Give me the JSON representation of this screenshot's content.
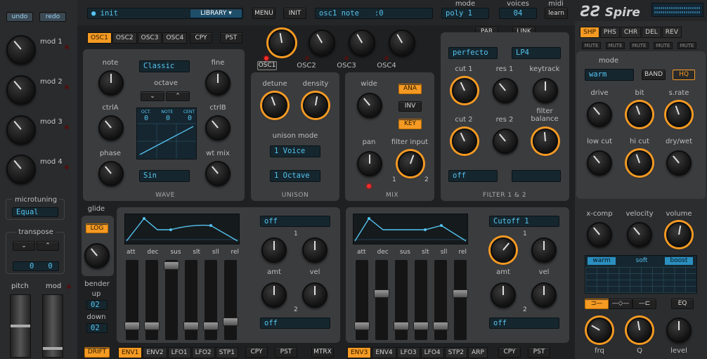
{
  "left": {
    "undo": "undo",
    "redo": "redo",
    "mods": [
      "mod 1",
      "mod 2",
      "mod 3",
      "mod 4"
    ],
    "microtuning_label": "microtuning",
    "microtuning_value": "Equal",
    "transpose_label": "transpose",
    "transpose_values": [
      "0",
      "0"
    ],
    "pitch": "pitch",
    "mod": "mod"
  },
  "topbar": {
    "patch": "init",
    "library": "LIBRARY",
    "menu": "MENU",
    "init": "INIT",
    "param_name": "osc1 note",
    "param_value": ":0",
    "mode_label": "mode",
    "mode_value": "poly 1",
    "voices_label": "voices",
    "voices_value": "04",
    "midi_label": "midi",
    "midi_learn": "learn",
    "logo": "Spire"
  },
  "osc": {
    "tabs": [
      "OSC1",
      "OSC2",
      "OSC3",
      "OSC4"
    ],
    "cpy": "CPY",
    "pst": "PST",
    "knobs": [
      "OSC1",
      "OSC2",
      "OSC3",
      "OSC4"
    ],
    "note": "note",
    "fine": "fine",
    "wave_mode": "Classic",
    "octave": "octave",
    "ctrlA": "ctrlA",
    "ctrlB": "ctrlB",
    "phase": "phase",
    "wtmix": "wt mix",
    "disp_heads": [
      "OCT.",
      "NOTE",
      "CENT"
    ],
    "disp_vals": [
      "0",
      "0",
      "0"
    ],
    "wave_shape": "Sin",
    "wave_title": "WAVE"
  },
  "unison": {
    "detune": "detune",
    "density": "density",
    "mode_label": "unison mode",
    "voice": "1 Voice",
    "octave": "1 Octave",
    "title": "UNISON"
  },
  "mix": {
    "wide": "wide",
    "ana": "ANA",
    "inv": "INV",
    "key": "KEY",
    "pan": "pan",
    "filter_input": "filter input",
    "one": "1",
    "two": "2",
    "title": "MIX"
  },
  "filter": {
    "par": "PAR",
    "link": "LINK",
    "f1_type": "perfecto",
    "f2_type": "LP4",
    "cut1": "cut 1",
    "res1": "res 1",
    "keytrack": "keytrack",
    "cut2": "cut 2",
    "res2": "res 2",
    "balance": "filter balance",
    "f1_off": "off",
    "title": "FILTER 1 & 2"
  },
  "fx": {
    "tabs": [
      "SHP",
      "PHS",
      "CHR",
      "DEL",
      "REV"
    ],
    "mute": "MUTE",
    "mode": "mode",
    "mode_val": "warm",
    "band": "BAND",
    "hq": "HQ",
    "drive": "drive",
    "bit": "bit",
    "srate": "s.rate",
    "lowcut": "low cut",
    "hicut": "hi cut",
    "drywet": "dry/wet",
    "xcomp": "x-comp",
    "velocity": "velocity",
    "volume": "volume",
    "eq_tabs": [
      "warm",
      "soft",
      "boost"
    ],
    "eq": "EQ",
    "frq": "frq",
    "q": "Q",
    "level": "level"
  },
  "env1": {
    "glide": "glide",
    "log": "LOG",
    "bender": "bender",
    "up": "up",
    "up_val": "02",
    "down": "down",
    "down_val": "02",
    "labels": [
      "att",
      "dec",
      "sus",
      "slt",
      "sll",
      "rel"
    ],
    "dest1": "off",
    "dest2": "off",
    "one": "1",
    "two": "2",
    "amt": "amt",
    "vel": "vel"
  },
  "env2": {
    "labels": [
      "att",
      "dec",
      "sus",
      "slt",
      "sll",
      "rel"
    ],
    "dest1": "Cutoff 1",
    "dest2": "off",
    "one": "1",
    "two": "2",
    "amt": "amt",
    "vel": "vel"
  },
  "bottom": {
    "drift": "DRIFT",
    "tabsL": [
      "ENV1",
      "ENV2",
      "LFO1",
      "LFO2",
      "STP1"
    ],
    "cpy": "CPY",
    "pst": "PST",
    "mtrx": "MTRX",
    "tabsR": [
      "ENV3",
      "ENV4",
      "LFO3",
      "LFO4",
      "STP2",
      "ARP"
    ]
  }
}
